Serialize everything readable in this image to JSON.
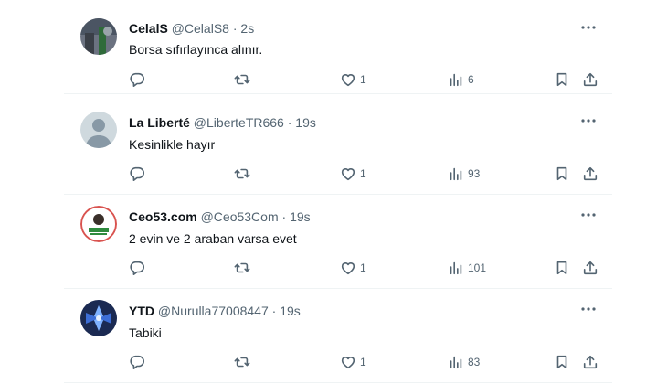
{
  "tweets": [
    {
      "name": "CelalS",
      "handle": "@CelalS8",
      "dot": "·",
      "time": "2s",
      "text": "Borsa sıfırlayınca alınır.",
      "likes": "1",
      "views": "6",
      "avatar": "photo-avatar"
    },
    {
      "name": "La Liberté",
      "handle": "@LiberteTR666",
      "dot": "·",
      "time": "19s",
      "text": "Kesinlikle hayır",
      "likes": "1",
      "views": "93",
      "avatar": "default-avatar"
    },
    {
      "name": "Ceo53.com",
      "handle": "@Ceo53Com",
      "dot": "·",
      "time": "19s",
      "text": "2 evin ve 2 araban varsa evet",
      "likes": "1",
      "views": "101",
      "avatar": "logo-avatar"
    },
    {
      "name": "YTD",
      "handle": "@Nurulla77008447",
      "dot": "·",
      "time": "19s",
      "text": "Tabiki",
      "likes": "1",
      "views": "83",
      "avatar": "blue-art-avatar"
    }
  ],
  "colors": {
    "text": "#0f1419",
    "muted": "#536471",
    "divider": "#eff3f4"
  },
  "icons": [
    "more-icon",
    "reply-icon",
    "retweet-icon",
    "like-icon",
    "views-icon",
    "bookmark-icon",
    "share-icon"
  ]
}
